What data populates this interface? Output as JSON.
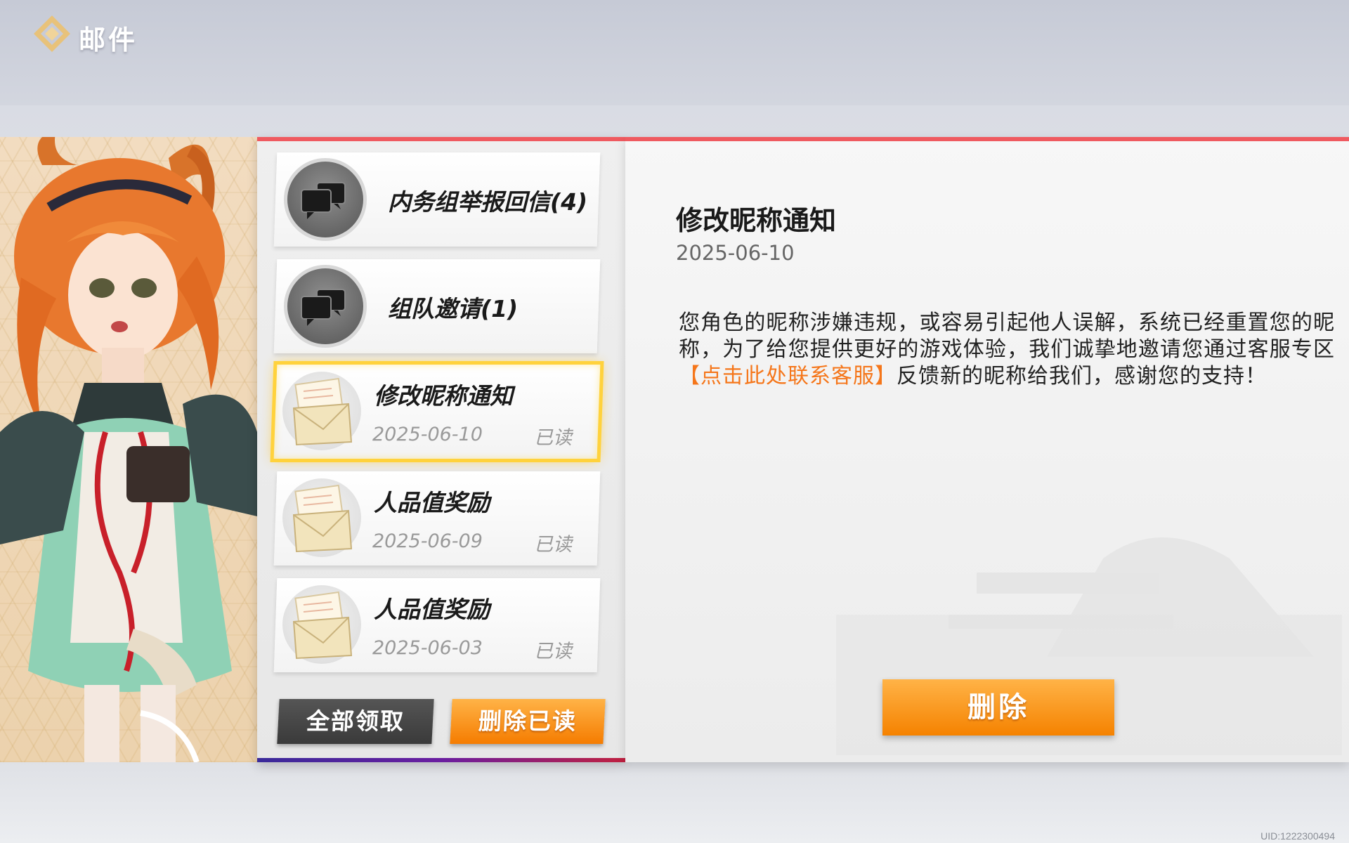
{
  "header": {
    "title": "邮件",
    "logo_icon": "diamond-logo-icon"
  },
  "mails": [
    {
      "title": "内务组举报回信(4)",
      "icon": "chat-bubbles-icon",
      "type": "group"
    },
    {
      "title": "组队邀请(1)",
      "icon": "chat-bubbles-icon",
      "type": "group"
    },
    {
      "title": "修改昵称通知",
      "date": "2025-06-10",
      "status": "已读",
      "icon": "envelope-icon",
      "selected": true
    },
    {
      "title": "人品值奖励",
      "date": "2025-06-09",
      "status": "已读",
      "icon": "envelope-icon"
    },
    {
      "title": "人品值奖励",
      "date": "2025-06-03",
      "status": "已读",
      "icon": "envelope-icon"
    }
  ],
  "actions": {
    "collect_all": "全部领取",
    "delete_read": "删除已读"
  },
  "detail": {
    "title": "修改昵称通知",
    "date": "2025-06-10",
    "body_part1": "您角色的昵称涉嫌违规，或容易引起他人误解，系统已经重置您的昵称，为了给您提供更好的游戏体验，我们诚挚地邀请您通过客服专区",
    "body_link": "【点击此处联系客服】",
    "body_part2": "反馈新的昵称给我们，感谢您的支持！",
    "delete_button": "删除"
  },
  "footer": {
    "uid": "UID:1222300494"
  },
  "colors": {
    "accent_orange": "#f57c00",
    "accent_red_line": "#ef5a60",
    "selected_outline": "#ffd23c",
    "link_orange": "#f5761a"
  }
}
